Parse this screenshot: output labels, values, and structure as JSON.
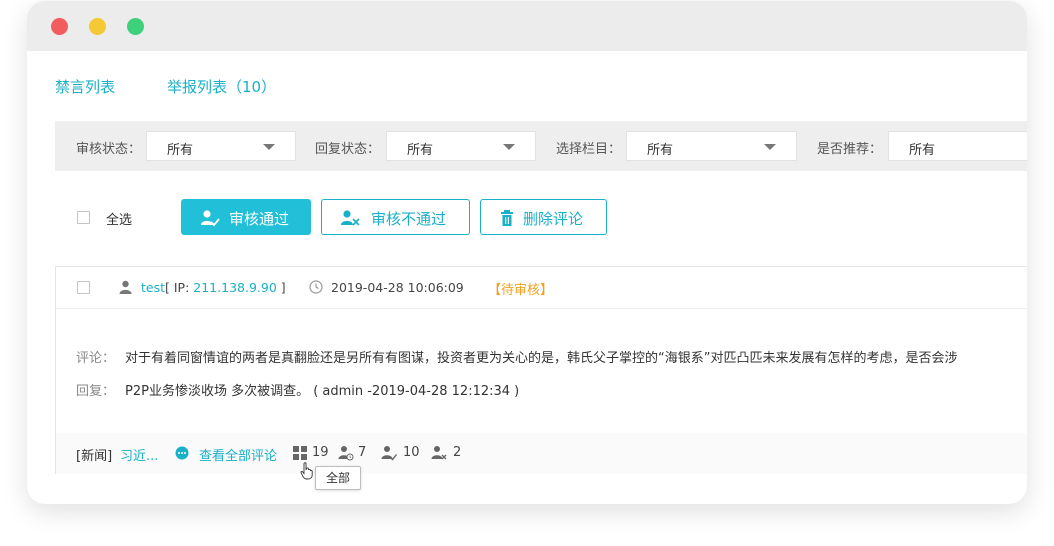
{
  "tabs": [
    {
      "label": "禁言列表"
    },
    {
      "label": "举报列表（10）"
    }
  ],
  "filters": [
    {
      "label": "审核状态：",
      "value": "所有"
    },
    {
      "label": "回复状态：",
      "value": "所有"
    },
    {
      "label": "选择栏目：",
      "value": "所有"
    },
    {
      "label": "是否推荐：",
      "value": "所有"
    }
  ],
  "actions": {
    "select_all": "全选",
    "approve": "审核通过",
    "reject": "审核不通过",
    "delete": "删除评论"
  },
  "comment": {
    "user": "test",
    "ip_prefix": "[ IP: ",
    "ip": "211.138.9.90",
    "ip_suffix": " ]",
    "time": "2019-04-28 10:06:09",
    "status": "【待审核】",
    "comment_label": "评论：",
    "comment_text": "对于有着同窗情谊的两者是真翻脸还是另所有有图谋，投资者更为关心的是，韩氏父子掌控的“海银系”对匹凸匹未来发展有怎样的考虑，是否会涉",
    "reply_label": "回复：",
    "reply_text": "P2P业务惨淡收场 多次被调查。 ( admin -2019-04-28 12:12:34 )",
    "category": "[新闻]",
    "article_link": "习近...",
    "view_all": "查看全部评论",
    "stats": {
      "all": "19",
      "pending": "7",
      "approved": "10",
      "rejected": "2"
    }
  },
  "tooltip": "全部",
  "colors": {
    "accent": "#1ab0c8",
    "pending": "#f0a020"
  }
}
